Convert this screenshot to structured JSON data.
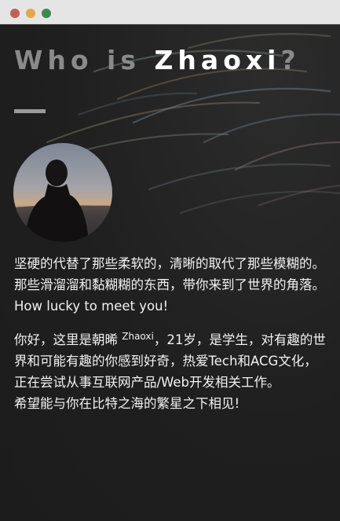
{
  "heading": {
    "prefix": "Who is ",
    "name": "Zhaoxi",
    "suffix": "?"
  },
  "intro": {
    "line1": "坚硬的代替了那些柔软的，清晰的取代了那些模糊的。那些滑溜溜和黏糊糊的东西，带你来到了世界的角落。",
    "line2": "How lucky to meet you!"
  },
  "about": {
    "before": "你好，这里是朝晞",
    "nickname": "Zhaoxi",
    "after": "，21岁，是学生，对有趣的世界和可能有趣的你感到好奇，热爱Tech和ACG文化，正在尝试从事互联网产品/Web开发相关工作。",
    "closing": "希望能与你在比特之海的繁星之下相见!"
  },
  "icons": {
    "avatar": "person-silhouette-photo"
  },
  "colors": {
    "heading_accent": "#ffffff",
    "heading_muted": "#8a8a8a",
    "background": "#1e1e1e"
  }
}
